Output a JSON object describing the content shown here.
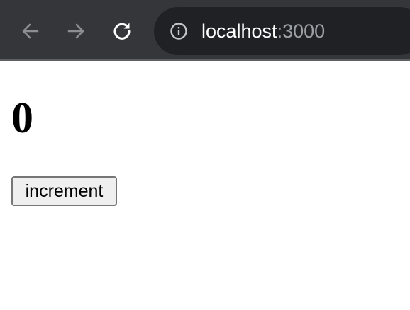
{
  "browser": {
    "address_bar": {
      "host": "localhost",
      "port": ":3000"
    },
    "icons": {
      "back": "arrow-left-icon",
      "forward": "arrow-right-icon",
      "reload": "reload-icon",
      "site_info": "info-icon"
    },
    "colors": {
      "toolbar": "#35363a",
      "omnibox": "#202124",
      "host_text": "#ffffff",
      "port_text": "#9aa0a6"
    }
  },
  "page": {
    "counter_value": "0",
    "increment_label": "increment"
  }
}
